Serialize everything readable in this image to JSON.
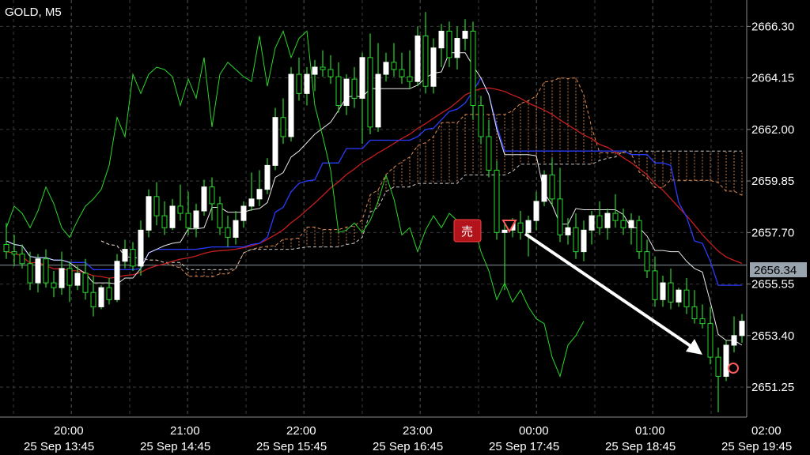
{
  "chart_data": {
    "type": "candlestick",
    "title": "GOLD, M5",
    "y_ticks": [
      "2666.30",
      "2664.15",
      "2662.00",
      "2659.85",
      "2657.70",
      "2655.55",
      "2653.40",
      "2651.25"
    ],
    "ylim": [
      2650.0,
      2667.4
    ],
    "current_price": "2656.34",
    "x_ticks_top": [
      "20:00",
      "21:00",
      "22:00",
      "23:00",
      "00:00",
      "01:00",
      "02:00"
    ],
    "x_ticks_bottom": [
      "25 Sep 13:45",
      "25 Sep 14:45",
      "25 Sep 15:45",
      "25 Sep 16:45",
      "25 Sep 17:45",
      "25 Sep 18:45",
      "25 Sep 19:45"
    ],
    "sell_label": "売",
    "candles": [
      [
        2657.2,
        2658.1,
        2656.6,
        2656.9
      ],
      [
        2656.9,
        2657.6,
        2656.3,
        2656.8
      ],
      [
        2656.8,
        2657.2,
        2656.2,
        2656.4
      ],
      [
        2656.4,
        2656.9,
        2655.3,
        2655.6
      ],
      [
        2655.6,
        2656.8,
        2655.2,
        2656.6
      ],
      [
        2656.6,
        2657.0,
        2655.4,
        2655.6
      ],
      [
        2655.6,
        2656.1,
        2655.0,
        2655.4
      ],
      [
        2655.4,
        2656.9,
        2655.1,
        2656.2
      ],
      [
        2656.2,
        2656.5,
        2654.8,
        2655.5
      ],
      [
        2655.5,
        2656.3,
        2655.3,
        2656.0
      ],
      [
        2656.0,
        2656.6,
        2654.9,
        2655.2
      ],
      [
        2655.2,
        2655.9,
        2654.2,
        2654.6
      ],
      [
        2654.6,
        2655.5,
        2654.5,
        2655.4
      ],
      [
        2655.4,
        2655.8,
        2654.7,
        2654.9
      ],
      [
        2654.9,
        2656.8,
        2654.8,
        2656.5
      ],
      [
        2656.5,
        2657.4,
        2656.2,
        2657.0
      ],
      [
        2657.0,
        2657.3,
        2656.1,
        2656.3
      ],
      [
        2656.3,
        2658.2,
        2655.9,
        2657.8
      ],
      [
        2657.8,
        2659.5,
        2657.5,
        2659.2
      ],
      [
        2659.2,
        2659.8,
        2658.0,
        2658.4
      ],
      [
        2658.4,
        2659.0,
        2657.6,
        2657.9
      ],
      [
        2657.9,
        2659.1,
        2657.8,
        2658.8
      ],
      [
        2658.8,
        2659.7,
        2658.2,
        2658.5
      ],
      [
        2658.5,
        2659.4,
        2657.6,
        2657.9
      ],
      [
        2657.9,
        2658.9,
        2657.5,
        2658.6
      ],
      [
        2658.6,
        2659.9,
        2658.4,
        2659.6
      ],
      [
        2659.6,
        2660.0,
        2658.2,
        2658.9
      ],
      [
        2658.9,
        2659.2,
        2657.6,
        2657.9
      ],
      [
        2657.9,
        2658.4,
        2657.1,
        2657.5
      ],
      [
        2657.5,
        2658.6,
        2657.2,
        2658.2
      ],
      [
        2658.2,
        2659.0,
        2657.9,
        2658.8
      ],
      [
        2658.8,
        2660.2,
        2658.6,
        2659.1
      ],
      [
        2659.1,
        2660.3,
        2658.8,
        2659.5
      ],
      [
        2659.5,
        2660.8,
        2659.3,
        2660.5
      ],
      [
        2660.5,
        2662.9,
        2660.3,
        2662.5
      ],
      [
        2662.5,
        2663.3,
        2661.4,
        2661.7
      ],
      [
        2661.7,
        2664.6,
        2661.5,
        2664.3
      ],
      [
        2664.3,
        2665.0,
        2663.2,
        2663.5
      ],
      [
        2663.5,
        2664.6,
        2663.0,
        2664.3
      ],
      [
        2664.3,
        2664.9,
        2663.6,
        2664.6
      ],
      [
        2664.6,
        2665.3,
        2664.2,
        2664.5
      ],
      [
        2664.5,
        2665.1,
        2663.9,
        2664.2
      ],
      [
        2664.2,
        2664.8,
        2662.7,
        2663.0
      ],
      [
        2663.0,
        2664.3,
        2662.6,
        2664.1
      ],
      [
        2664.1,
        2664.6,
        2662.9,
        2663.3
      ],
      [
        2663.3,
        2665.2,
        2661.4,
        2665.0
      ],
      [
        2665.0,
        2666.0,
        2661.8,
        2662.1
      ],
      [
        2662.1,
        2665.6,
        2661.9,
        2664.3
      ],
      [
        2664.3,
        2665.2,
        2664.0,
        2664.8
      ],
      [
        2664.8,
        2665.6,
        2664.2,
        2664.5
      ],
      [
        2664.5,
        2665.2,
        2663.9,
        2664.2
      ],
      [
        2664.2,
        2665.3,
        2663.7,
        2664.0
      ],
      [
        2664.0,
        2666.3,
        2663.8,
        2665.9
      ],
      [
        2665.9,
        2666.9,
        2663.5,
        2663.8
      ],
      [
        2663.8,
        2665.8,
        2663.5,
        2665.4
      ],
      [
        2665.4,
        2666.4,
        2664.6,
        2666.1
      ],
      [
        2666.1,
        2666.5,
        2664.6,
        2665.0
      ],
      [
        2665.0,
        2666.3,
        2664.5,
        2665.8
      ],
      [
        2665.8,
        2666.6,
        2665.3,
        2666.1
      ],
      [
        2666.1,
        2666.5,
        2662.4,
        2663.0
      ],
      [
        2663.0,
        2663.4,
        2661.4,
        2661.7
      ],
      [
        2661.7,
        2662.4,
        2660.0,
        2660.3
      ],
      [
        2660.3,
        2660.7,
        2657.4,
        2657.7
      ],
      [
        2657.7,
        2658.2,
        2655.3,
        2657.8
      ],
      [
        2657.8,
        2658.3,
        2657.5,
        2658.1
      ],
      [
        2658.1,
        2658.6,
        2657.4,
        2657.7
      ],
      [
        2657.7,
        2658.4,
        2656.7,
        2658.2
      ],
      [
        2658.2,
        2659.4,
        2657.8,
        2659.0
      ],
      [
        2659.0,
        2660.3,
        2658.8,
        2660.1
      ],
      [
        2660.1,
        2660.8,
        2658.8,
        2659.1
      ],
      [
        2659.1,
        2660.4,
        2657.3,
        2657.6
      ],
      [
        2657.6,
        2658.3,
        2657.2,
        2657.9
      ],
      [
        2657.9,
        2658.5,
        2656.6,
        2656.9
      ],
      [
        2656.9,
        2658.2,
        2656.5,
        2657.8
      ],
      [
        2657.8,
        2658.6,
        2657.2,
        2658.4
      ],
      [
        2658.4,
        2659.0,
        2657.6,
        2657.9
      ],
      [
        2657.9,
        2658.7,
        2657.4,
        2658.5
      ],
      [
        2658.5,
        2659.3,
        2657.9,
        2658.2
      ],
      [
        2658.2,
        2658.7,
        2657.6,
        2657.9
      ],
      [
        2657.9,
        2658.5,
        2657.2,
        2658.2
      ],
      [
        2658.2,
        2658.4,
        2656.6,
        2656.9
      ],
      [
        2656.9,
        2657.4,
        2655.8,
        2656.1
      ],
      [
        2656.1,
        2656.7,
        2654.6,
        2654.9
      ],
      [
        2654.9,
        2655.9,
        2654.6,
        2655.6
      ],
      [
        2655.6,
        2656.2,
        2654.5,
        2654.8
      ],
      [
        2654.8,
        2655.4,
        2654.6,
        2655.3
      ],
      [
        2655.3,
        2655.8,
        2654.3,
        2654.6
      ],
      [
        2654.6,
        2655.3,
        2653.9,
        2654.1
      ],
      [
        2654.1,
        2654.7,
        2653.7,
        2653.9
      ],
      [
        2653.9,
        2654.6,
        2652.2,
        2652.5
      ],
      [
        2652.5,
        2652.9,
        2650.2,
        2651.7
      ],
      [
        2651.7,
        2653.2,
        2651.5,
        2653.0
      ],
      [
        2653.0,
        2654.2,
        2652.7,
        2653.4
      ],
      [
        2653.4,
        2654.3,
        2653.1,
        2654.0
      ]
    ]
  }
}
